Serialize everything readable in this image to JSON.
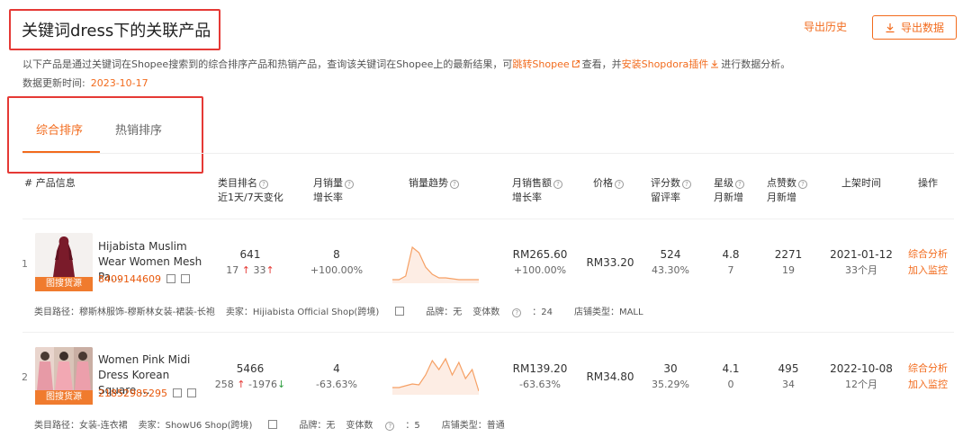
{
  "header": {
    "title": "关键词dress下的关联产品",
    "history_label": "导出历史",
    "export_label": "导出数据"
  },
  "description": {
    "part1": "以下产品是通过关键词在Shopee搜索到的综合排序产品和热销产品，查询该关键词在Shopee上的最新结果，可",
    "link1": "跳转Shopee",
    "part2": "查看，并",
    "link2": "安装Shopdora插件",
    "part3": "进行数据分析。"
  },
  "update": {
    "label": "数据更新时间:",
    "date": "2023-10-17"
  },
  "tabs": [
    {
      "label": "综合排序",
      "active": true
    },
    {
      "label": "热销排序",
      "active": false
    }
  ],
  "columns": {
    "info": "# 产品信息",
    "rank": "类目排名",
    "rank_sub": "近1天/7天变化",
    "sales": "月销量",
    "sales_sub": "增长率",
    "trend": "销量趋势",
    "revenue": "月销售额",
    "revenue_sub": "增长率",
    "price": "价格",
    "rating_count": "评分数",
    "rating_count_sub": "留评率",
    "stars": "星级",
    "stars_sub": "月新增",
    "likes": "点赞数",
    "likes_sub": "月新增",
    "listed": "上架时间",
    "ops": "操作"
  },
  "products": [
    {
      "index": "1",
      "name": "Hijabista Muslim Wear Women Mesh Pa...",
      "id": "8409144609",
      "badge": "图搜货源",
      "rank": "641",
      "rank_d1": "17",
      "rank_d7": "33",
      "sales": "8",
      "sales_growth": "+100.00%",
      "revenue": "RM265.60",
      "revenue_growth": "+100.00%",
      "price": "RM33.20",
      "rating_count": "524",
      "review_rate": "43.30%",
      "stars": "4.8",
      "stars_new": "7",
      "likes": "2271",
      "likes_new": "19",
      "listed": "2021-01-12",
      "listed_age": "33个月",
      "op1": "综合分析",
      "op2": "加入监控",
      "meta": {
        "category": "类目路径：穆斯林服饰-穆斯林女装-裙装-长袍",
        "seller": "卖家：Hijiabista Official Shop(跨境)",
        "brand": "品牌：无",
        "variants": "变体数",
        "variants_val": "：24",
        "shop_type": "店铺类型：MALL"
      }
    },
    {
      "index": "2",
      "name": "Women Pink Midi Dress Korean Square ...",
      "id": "21852985295",
      "badge": "图搜货源",
      "rank": "5466",
      "rank_d1": "258",
      "rank_d7": "-1976",
      "sales": "4",
      "sales_growth": "-63.63%",
      "revenue": "RM139.20",
      "revenue_growth": "-63.63%",
      "price": "RM34.80",
      "rating_count": "30",
      "review_rate": "35.29%",
      "stars": "4.1",
      "stars_new": "0",
      "likes": "495",
      "likes_new": "34",
      "listed": "2022-10-08",
      "listed_age": "12个月",
      "op1": "综合分析",
      "op2": "加入监控",
      "meta": {
        "category": "类目路径：女装-连衣裙",
        "seller": "卖家：ShowU6 Shop(跨境)",
        "brand": "品牌：无",
        "variants": "变体数",
        "variants_val": "：5",
        "shop_type": "店铺类型：普通"
      }
    }
  ],
  "colors": {
    "accent": "#f26b1d",
    "highlight_box": "#e53935",
    "up": "#e53935",
    "down": "#2e9d3f"
  },
  "icons": [
    "external-link-icon",
    "copy-icon",
    "download-icon",
    "help-icon",
    "arrow-up-icon",
    "arrow-down-icon"
  ]
}
